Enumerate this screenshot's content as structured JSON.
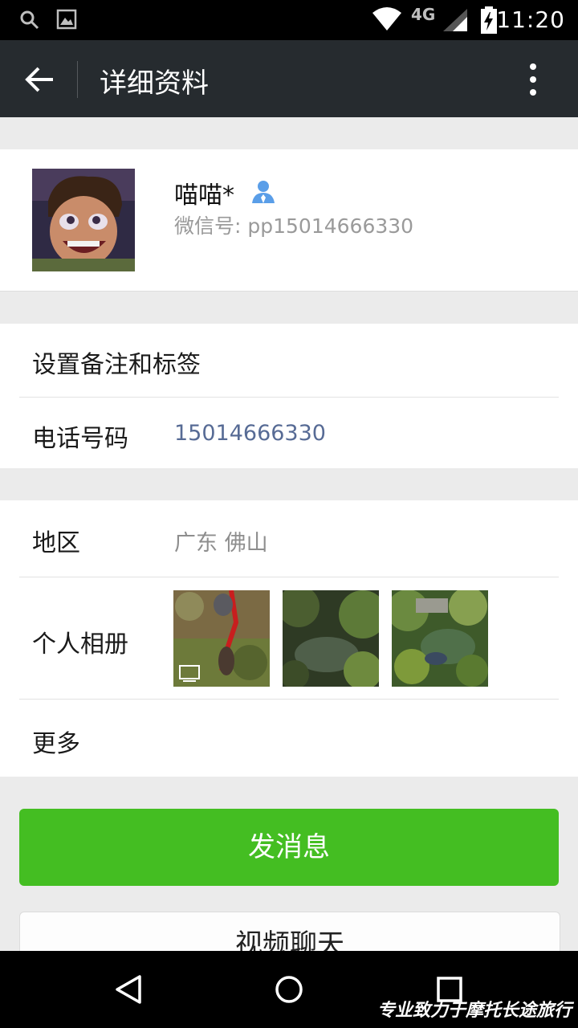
{
  "status_bar": {
    "network": "4G",
    "time": "11:20"
  },
  "app_bar": {
    "title": "详细资料"
  },
  "profile": {
    "nickname": "喵喵*",
    "wechat_id": "微信号: pp15014666330"
  },
  "rows": {
    "set_remark": "设置备注和标签",
    "phone_label": "电话号码",
    "phone_value": "15014666330",
    "region_label": "地区",
    "region_value": "广东  佛山",
    "album_label": "个人相册",
    "more_label": "更多"
  },
  "buttons": {
    "send_message": "发消息",
    "video_chat": "视频聊天"
  },
  "watermark": "专业致力于摩托长途旅行",
  "colors": {
    "primary_green": "#44be22",
    "phone_blue": "#576b95",
    "appbar": "#262b2f"
  }
}
